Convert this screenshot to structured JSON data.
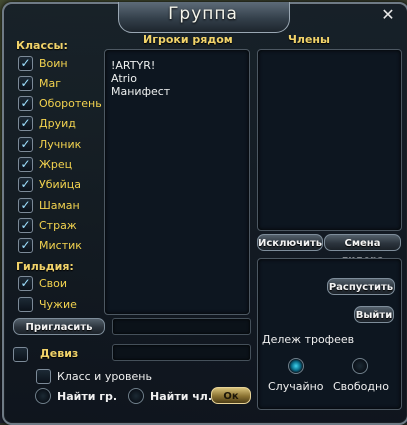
{
  "window": {
    "title": "Группа",
    "close_glyph": "✕"
  },
  "headers": {
    "nearby": "Игроки рядом",
    "members": "Члены"
  },
  "classes": {
    "label": "Классы:",
    "items": [
      {
        "label": "Воин",
        "checked": true
      },
      {
        "label": "Маг",
        "checked": true
      },
      {
        "label": "Оборотень",
        "checked": true
      },
      {
        "label": "Друид",
        "checked": true
      },
      {
        "label": "Лучник",
        "checked": true
      },
      {
        "label": "Жрец",
        "checked": true
      },
      {
        "label": "Убийца",
        "checked": true
      },
      {
        "label": "Шаман",
        "checked": true
      },
      {
        "label": "Страж",
        "checked": true
      },
      {
        "label": "Мистик",
        "checked": true
      }
    ]
  },
  "guild": {
    "label": "Гильдия:",
    "items": [
      {
        "label": "Свои",
        "checked": true
      },
      {
        "label": "Чужие",
        "checked": false
      }
    ]
  },
  "nearby_players": [
    "!ARTYR!",
    "Atrio",
    "Манифест"
  ],
  "buttons": {
    "invite": "Пригласить",
    "kick": "Исключить",
    "change_leader": "Смена лидера",
    "disband": "Распустить",
    "leave": "Выйти",
    "ok": "Ок"
  },
  "motto": {
    "label": "Девиз",
    "checked": false
  },
  "class_level": {
    "label": "Класс и уровень",
    "checked": false
  },
  "search": {
    "find_group": "Найти гр.",
    "find_member": "Найти чл."
  },
  "loot": {
    "label": "Дележ трофеев",
    "options": [
      {
        "label": "Случайно",
        "selected": true
      },
      {
        "label": "Свободно",
        "selected": false
      }
    ]
  },
  "check_glyph": "✓",
  "colors": {
    "accent_gold": "#f1d36a",
    "checkbox_mark": "#9fe0ff",
    "panel_bg": "#0d1620"
  }
}
